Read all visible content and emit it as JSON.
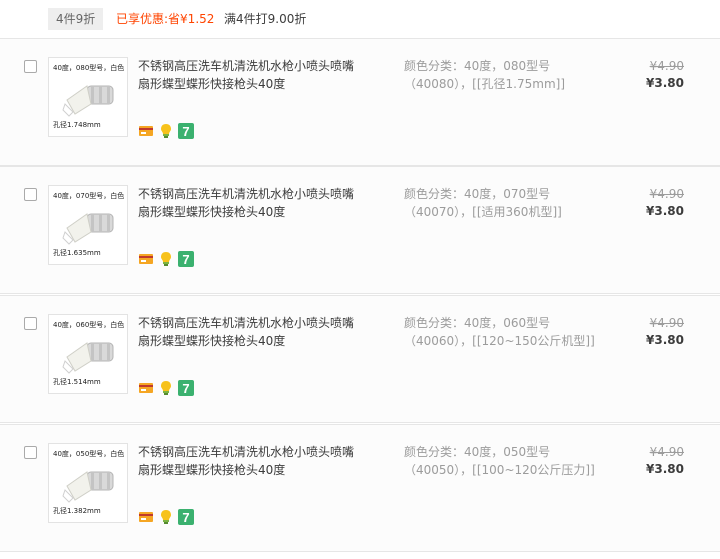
{
  "promo": {
    "tag": "4件9折",
    "saved": "已享优惠:省¥1.52",
    "rule": "满4件打9.00折"
  },
  "colors": {
    "accent": "#ff4400",
    "badge_green": "#3bb16f",
    "badge_card": "#f5a623"
  },
  "items": [
    {
      "thumb_label": "40度，080型号，白色",
      "thumb_caption": "孔径1.748mm",
      "title": "不锈钢高压洗车机清洗机水枪小喷头喷嘴扇形蝶型蝶形快接枪头40度",
      "sku_line1": "颜色分类：40度，080型号",
      "sku_line2": "（40080），[[孔径1.75mm]]",
      "price_original": "¥4.90",
      "price_now": "¥3.80",
      "icons": [
        "card-icon",
        "lamp-icon",
        "seven-day-icon"
      ]
    },
    {
      "thumb_label": "40度，070型号，白色",
      "thumb_caption": "孔径1.635mm",
      "title": "不锈钢高压洗车机清洗机水枪小喷头喷嘴扇形蝶型蝶形快接枪头40度",
      "sku_line1": "颜色分类：40度，070型号",
      "sku_line2": "（40070），[[适用360机型]]",
      "price_original": "¥4.90",
      "price_now": "¥3.80",
      "icons": [
        "card-icon",
        "lamp-icon",
        "seven-day-icon"
      ]
    },
    {
      "thumb_label": "40度，060型号，白色",
      "thumb_caption": "孔径1.514mm",
      "title": "不锈钢高压洗车机清洗机水枪小喷头喷嘴扇形蝶型蝶形快接枪头40度",
      "sku_line1": "颜色分类：40度，060型号",
      "sku_line2": "（40060），[[120~150公斤机型]]",
      "price_original": "¥4.90",
      "price_now": "¥3.80",
      "icons": [
        "card-icon",
        "lamp-icon",
        "seven-day-icon"
      ]
    },
    {
      "thumb_label": "40度，050型号，白色",
      "thumb_caption": "孔径1.382mm",
      "title": "不锈钢高压洗车机清洗机水枪小喷头喷嘴扇形蝶型蝶形快接枪头40度",
      "sku_line1": "颜色分类：40度，050型号",
      "sku_line2": "（40050），[[100~120公斤压力]]",
      "price_original": "¥4.90",
      "price_now": "¥3.80",
      "icons": [
        "card-icon",
        "lamp-icon",
        "seven-day-icon"
      ]
    }
  ]
}
